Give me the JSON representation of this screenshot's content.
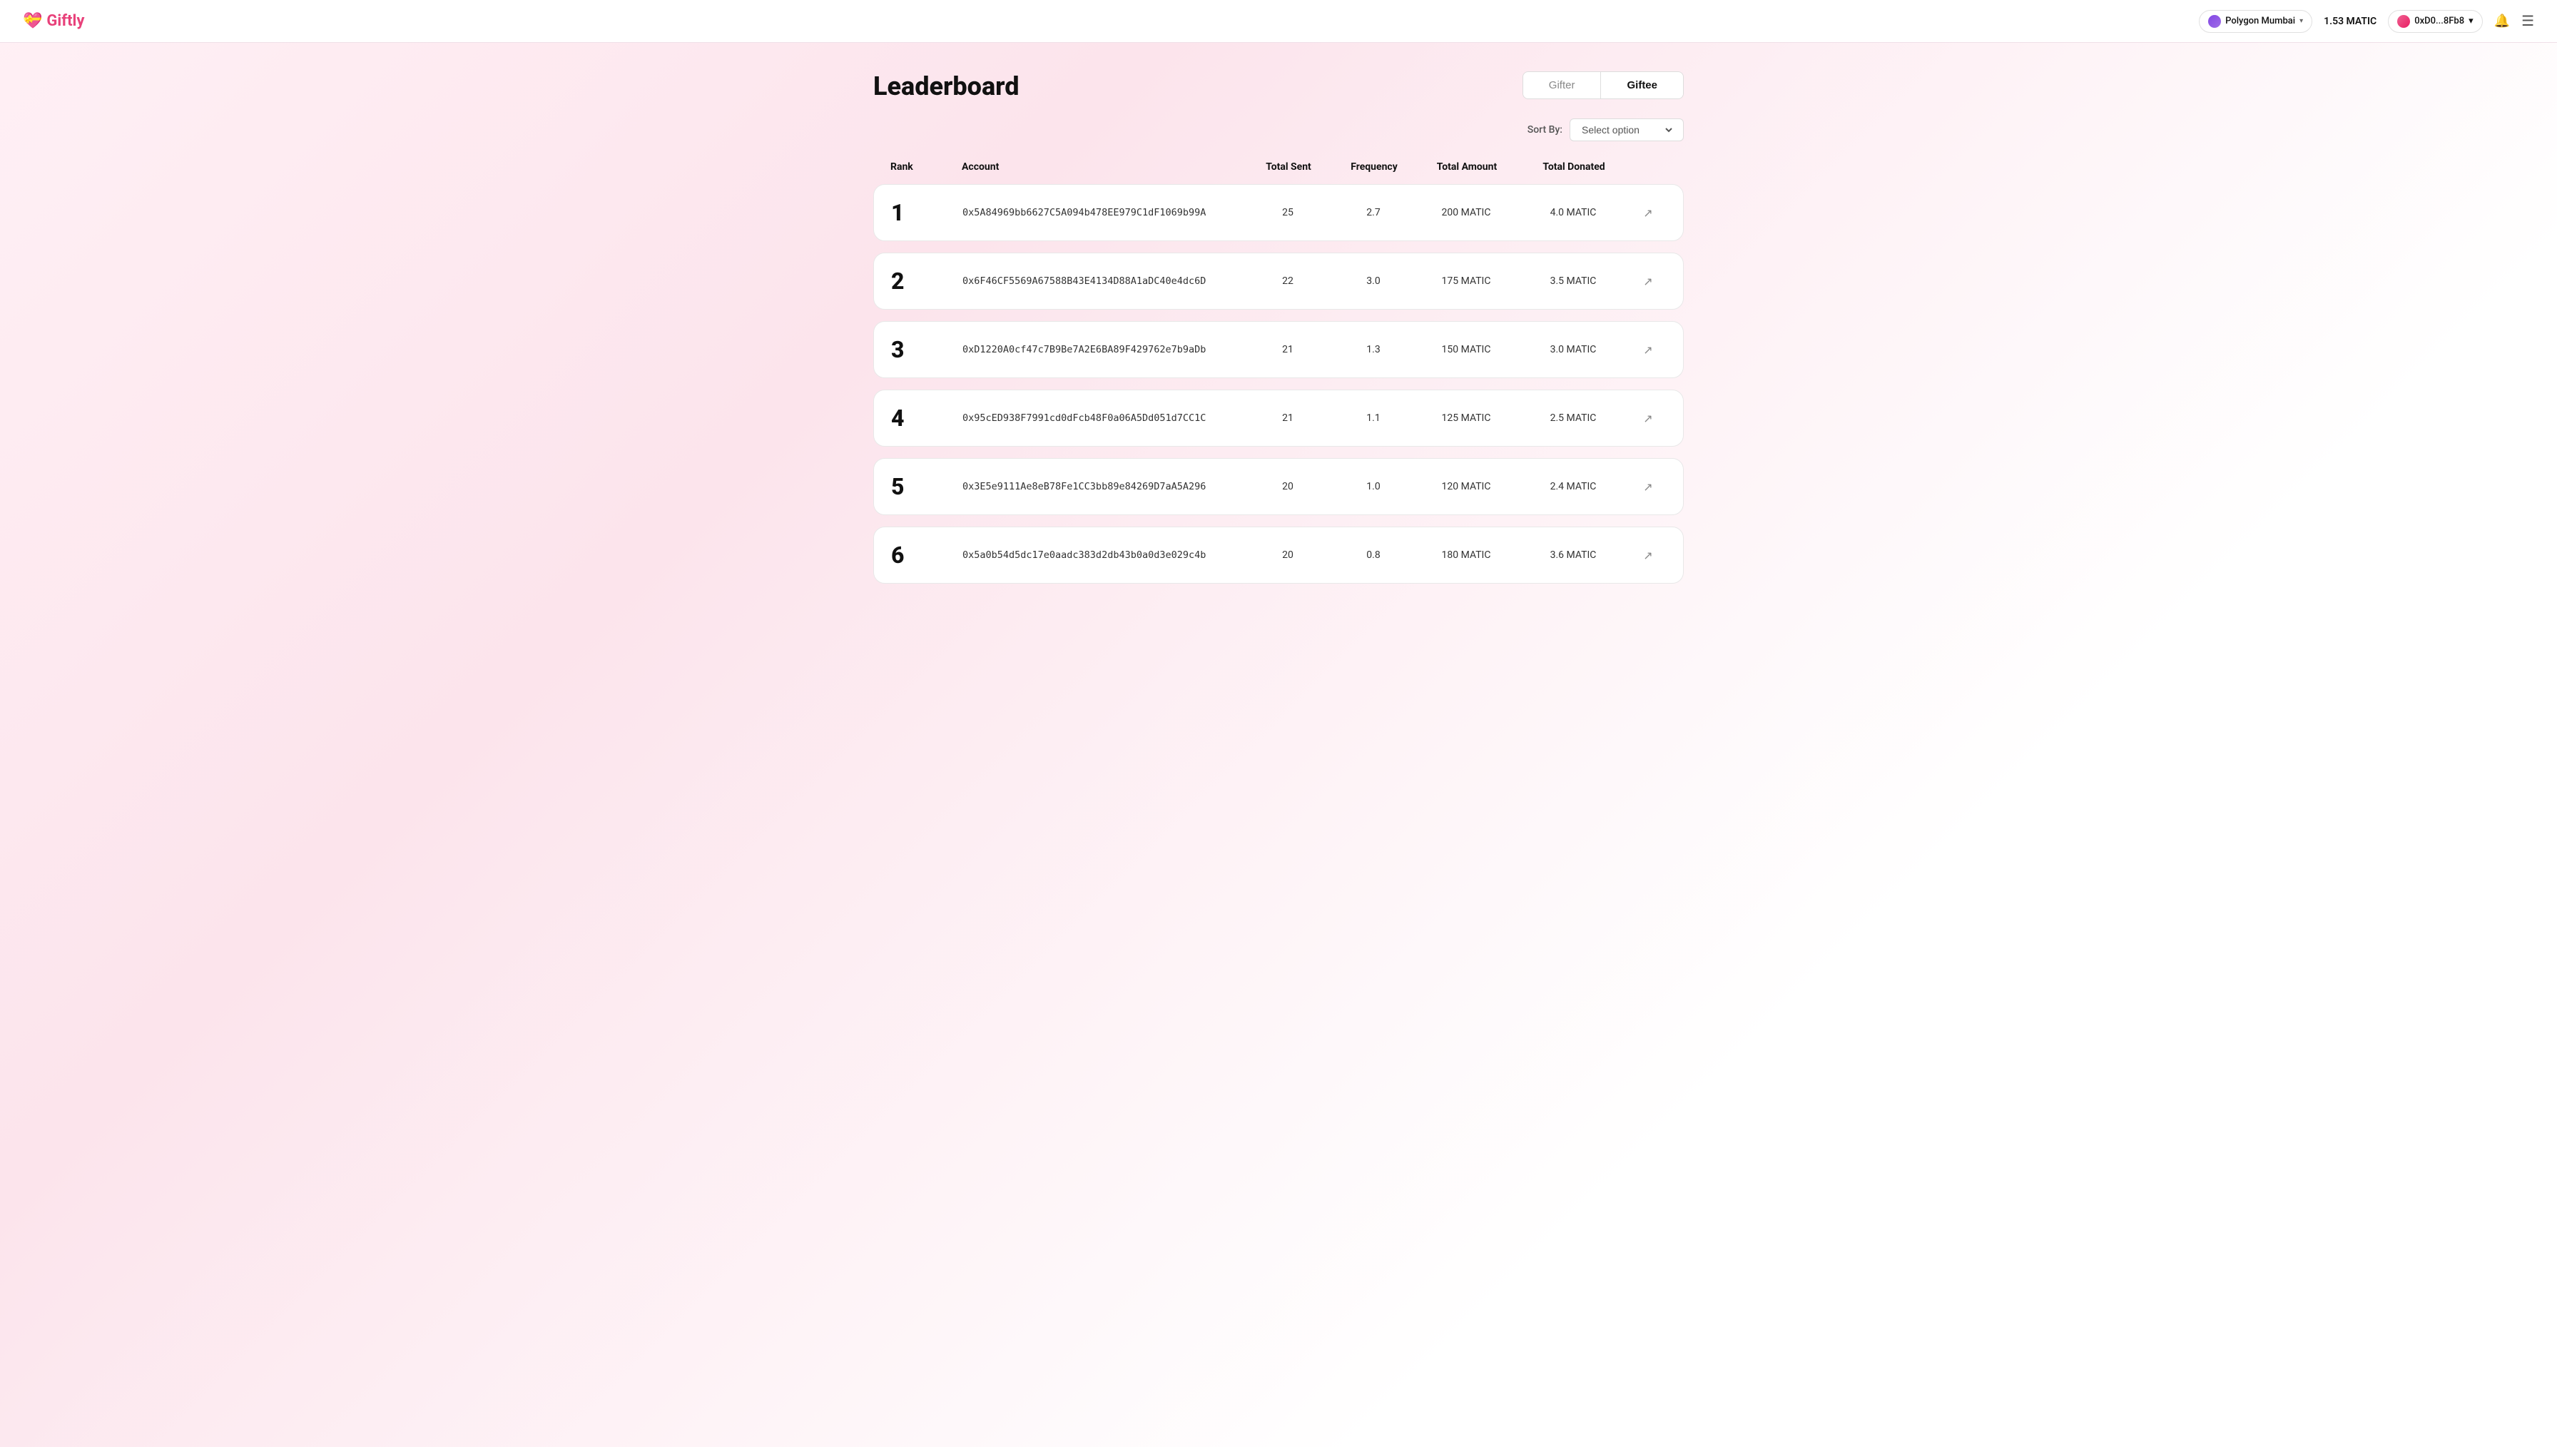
{
  "app": {
    "logo_emoji": "💝",
    "logo_text": "Giftly"
  },
  "navbar": {
    "network_label": "Polygon Mumbai",
    "balance": "1.53 MATIC",
    "wallet_address": "0xD0...8Fb8"
  },
  "leaderboard": {
    "title": "Leaderboard",
    "toggle": {
      "gifter_label": "Gifter",
      "giftee_label": "Giftee"
    },
    "sort_by_label": "Sort By:",
    "sort_placeholder": "Select option",
    "columns": {
      "rank": "Rank",
      "account": "Account",
      "total_sent": "Total Sent",
      "frequency": "Frequency",
      "total_amount": "Total Amount",
      "total_donated": "Total Donated"
    },
    "rows": [
      {
        "rank": "1",
        "account": "0x5A84969bb6627C5A094b478EE979C1dF1069b99A",
        "total_sent": "25",
        "frequency": "2.7",
        "total_amount": "200 MATIC",
        "total_donated": "4.0 MATIC"
      },
      {
        "rank": "2",
        "account": "0x6F46CF5569A67588B43E4134D88A1aDC40e4dc6D",
        "total_sent": "22",
        "frequency": "3.0",
        "total_amount": "175 MATIC",
        "total_donated": "3.5 MATIC"
      },
      {
        "rank": "3",
        "account": "0xD1220A0cf47c7B9Be7A2E6BA89F429762e7b9aDb",
        "total_sent": "21",
        "frequency": "1.3",
        "total_amount": "150 MATIC",
        "total_donated": "3.0 MATIC"
      },
      {
        "rank": "4",
        "account": "0x95cED938F7991cd0dFcb48F0a06A5Dd051d7CC1C",
        "total_sent": "21",
        "frequency": "1.1",
        "total_amount": "125 MATIC",
        "total_donated": "2.5 MATIC"
      },
      {
        "rank": "5",
        "account": "0x3E5e9111Ae8eB78Fe1CC3bb89e84269D7aA5A296",
        "total_sent": "20",
        "frequency": "1.0",
        "total_amount": "120 MATIC",
        "total_donated": "2.4 MATIC"
      },
      {
        "rank": "6",
        "account": "0x5a0b54d5dc17e0aadc383d2db43b0a0d3e029c4b",
        "total_sent": "20",
        "frequency": "0.8",
        "total_amount": "180 MATIC",
        "total_donated": "3.6 MATIC"
      }
    ]
  }
}
